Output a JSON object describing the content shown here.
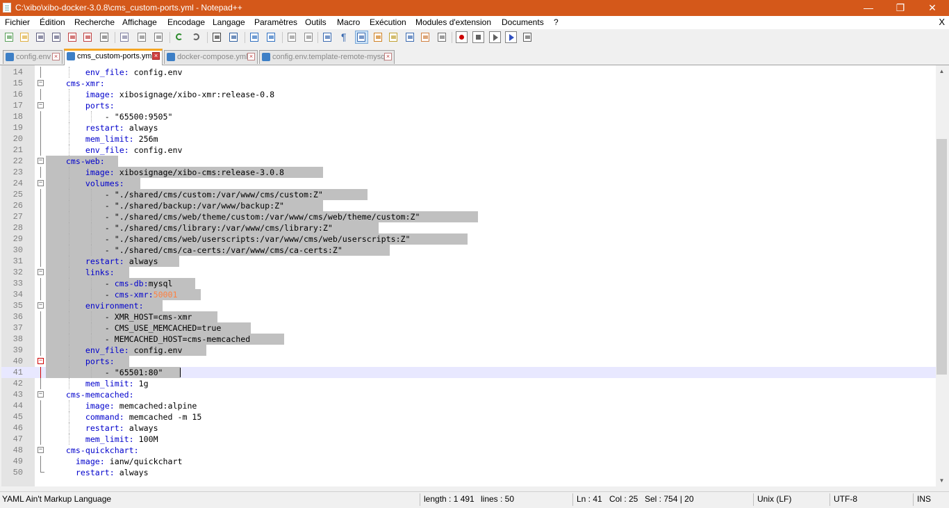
{
  "window": {
    "title": "C:\\xibo\\xibo-docker-3.0.8\\cms_custom-ports.yml - Notepad++",
    "minimize": "—",
    "restore": "❐",
    "close": "✕"
  },
  "menu": {
    "items": [
      "Fichier",
      "Édition",
      "Recherche",
      "Affichage",
      "Encodage",
      "Langage",
      "Paramètres",
      "Outils",
      "Macro",
      "Exécution",
      "Modules d'extension",
      "Documents",
      "?"
    ],
    "close_doc": "X"
  },
  "tabs": [
    {
      "label": "config.env",
      "active": false
    },
    {
      "label": "cms_custom-ports.yml",
      "active": true
    },
    {
      "label": "docker-compose.yml",
      "active": false
    },
    {
      "label": "config.env.template-remote-mysql",
      "active": false
    }
  ],
  "editor": {
    "lines": [
      {
        "n": "14",
        "indent": 8,
        "key": "env_file",
        "val": "config.env"
      },
      {
        "n": "15",
        "indent": 4,
        "key": "cms-xmr",
        "val": ""
      },
      {
        "n": "16",
        "indent": 8,
        "key": "image",
        "val": "xibosignage/xibo-xmr:release-0.8"
      },
      {
        "n": "17",
        "indent": 8,
        "key": "ports",
        "val": ""
      },
      {
        "n": "18",
        "indent": 12,
        "dash": "- ",
        "val": "\"65500:9505\""
      },
      {
        "n": "19",
        "indent": 8,
        "key": "restart",
        "val": "always"
      },
      {
        "n": "20",
        "indent": 8,
        "key": "mem_limit",
        "val": "256m"
      },
      {
        "n": "21",
        "indent": 8,
        "key": "env_file",
        "val": "config.env"
      },
      {
        "n": "22",
        "indent": 4,
        "key": "cms-web",
        "val": ""
      },
      {
        "n": "23",
        "indent": 8,
        "key": "image",
        "val": "xibosignage/xibo-cms:release-3.0.8"
      },
      {
        "n": "24",
        "indent": 8,
        "key": "volumes",
        "val": ""
      },
      {
        "n": "25",
        "indent": 12,
        "dash": "- ",
        "val": "\"./shared/cms/custom:/var/www/cms/custom:Z\""
      },
      {
        "n": "26",
        "indent": 12,
        "dash": "- ",
        "val": "\"./shared/backup:/var/www/backup:Z\""
      },
      {
        "n": "27",
        "indent": 12,
        "dash": "- ",
        "val": "\"./shared/cms/web/theme/custom:/var/www/cms/web/theme/custom:Z\""
      },
      {
        "n": "28",
        "indent": 12,
        "dash": "- ",
        "val": "\"./shared/cms/library:/var/www/cms/library:Z\""
      },
      {
        "n": "29",
        "indent": 12,
        "dash": "- ",
        "val": "\"./shared/cms/web/userscripts:/var/www/cms/web/userscripts:Z\""
      },
      {
        "n": "30",
        "indent": 12,
        "dash": "- ",
        "val": "\"./shared/cms/ca-certs:/var/www/cms/ca-certs:Z\""
      },
      {
        "n": "31",
        "indent": 8,
        "key": "restart",
        "val": "always"
      },
      {
        "n": "32",
        "indent": 8,
        "key": "links",
        "val": ""
      },
      {
        "n": "33",
        "indent": 12,
        "dash": "- ",
        "key": "cms-db",
        "val": "mysql"
      },
      {
        "n": "34",
        "indent": 12,
        "dash": "- ",
        "key": "cms-xmr",
        "num": "50001"
      },
      {
        "n": "35",
        "indent": 8,
        "key": "environment",
        "val": ""
      },
      {
        "n": "36",
        "indent": 12,
        "dash": "- ",
        "val": "XMR_HOST=cms-xmr"
      },
      {
        "n": "37",
        "indent": 12,
        "dash": "- ",
        "val": "CMS_USE_MEMCACHED=true"
      },
      {
        "n": "38",
        "indent": 12,
        "dash": "- ",
        "val": "MEMCACHED_HOST=cms-memcached"
      },
      {
        "n": "39",
        "indent": 8,
        "key": "env_file",
        "val": "config.env"
      },
      {
        "n": "40",
        "indent": 8,
        "key": "ports",
        "val": ""
      },
      {
        "n": "41",
        "indent": 12,
        "dash": "- ",
        "val": "\"65501:80\""
      },
      {
        "n": "42",
        "indent": 8,
        "key": "mem_limit",
        "val": "1g"
      },
      {
        "n": "43",
        "indent": 4,
        "key": "cms-memcached",
        "val": ""
      },
      {
        "n": "44",
        "indent": 8,
        "key": "image",
        "val": "memcached:alpine"
      },
      {
        "n": "45",
        "indent": 8,
        "key": "command",
        "val": "memcached -m 15"
      },
      {
        "n": "46",
        "indent": 8,
        "key": "restart",
        "val": "always"
      },
      {
        "n": "47",
        "indent": 8,
        "key": "mem_limit",
        "val": "100M"
      },
      {
        "n": "48",
        "indent": 4,
        "key": "cms-quickchart",
        "val": ""
      },
      {
        "n": "49",
        "indent": 6,
        "key": "image",
        "val": "ianw/quickchart"
      },
      {
        "n": "50",
        "indent": 6,
        "key": "restart",
        "val": "always"
      }
    ],
    "selected_lines": [
      "22",
      "23",
      "24",
      "25",
      "26",
      "27",
      "28",
      "29",
      "30",
      "31",
      "32",
      "33",
      "34",
      "35",
      "36",
      "37",
      "38",
      "39",
      "40",
      "41"
    ],
    "current_line": "41",
    "fold_boxes": [
      "15",
      "17",
      "22",
      "24",
      "32",
      "35",
      "40",
      "43",
      "48"
    ]
  },
  "statusbar": {
    "language": "YAML Ain't Markup Language",
    "length": "length : 1 491",
    "lines": "lines : 50",
    "ln": "Ln : 41",
    "col": "Col : 25",
    "sel": "Sel : 754 | 20",
    "eol": "Unix (LF)",
    "encoding": "UTF-8",
    "mode": "INS"
  },
  "colors": {
    "titlebar": "#d4581a",
    "keyword": "#0000cc",
    "number": "#ff8040",
    "selection": "#c0c0c0",
    "current_line": "#e8e8ff",
    "active_tab_accent": "#f5a623"
  },
  "toolbar_icons": [
    "new-file-icon",
    "open-file-icon",
    "save-icon",
    "save-all-icon",
    "close-icon",
    "close-all-icon",
    "print-icon",
    "cut-icon",
    "copy-icon",
    "paste-icon",
    "undo-icon",
    "redo-icon",
    "find-icon",
    "replace-icon",
    "zoom-in-icon",
    "zoom-out-icon",
    "sync-vertical-icon",
    "sync-horizontal-icon",
    "word-wrap-icon",
    "show-all-chars-icon",
    "indent-guide-icon",
    "lang-xml-icon",
    "doc-map-icon",
    "function-list-icon",
    "folder-workspace-icon",
    "monitoring-icon",
    "record-macro-icon",
    "stop-record-icon",
    "play-macro-icon",
    "run-macro-multiple-icon",
    "save-macro-icon"
  ]
}
